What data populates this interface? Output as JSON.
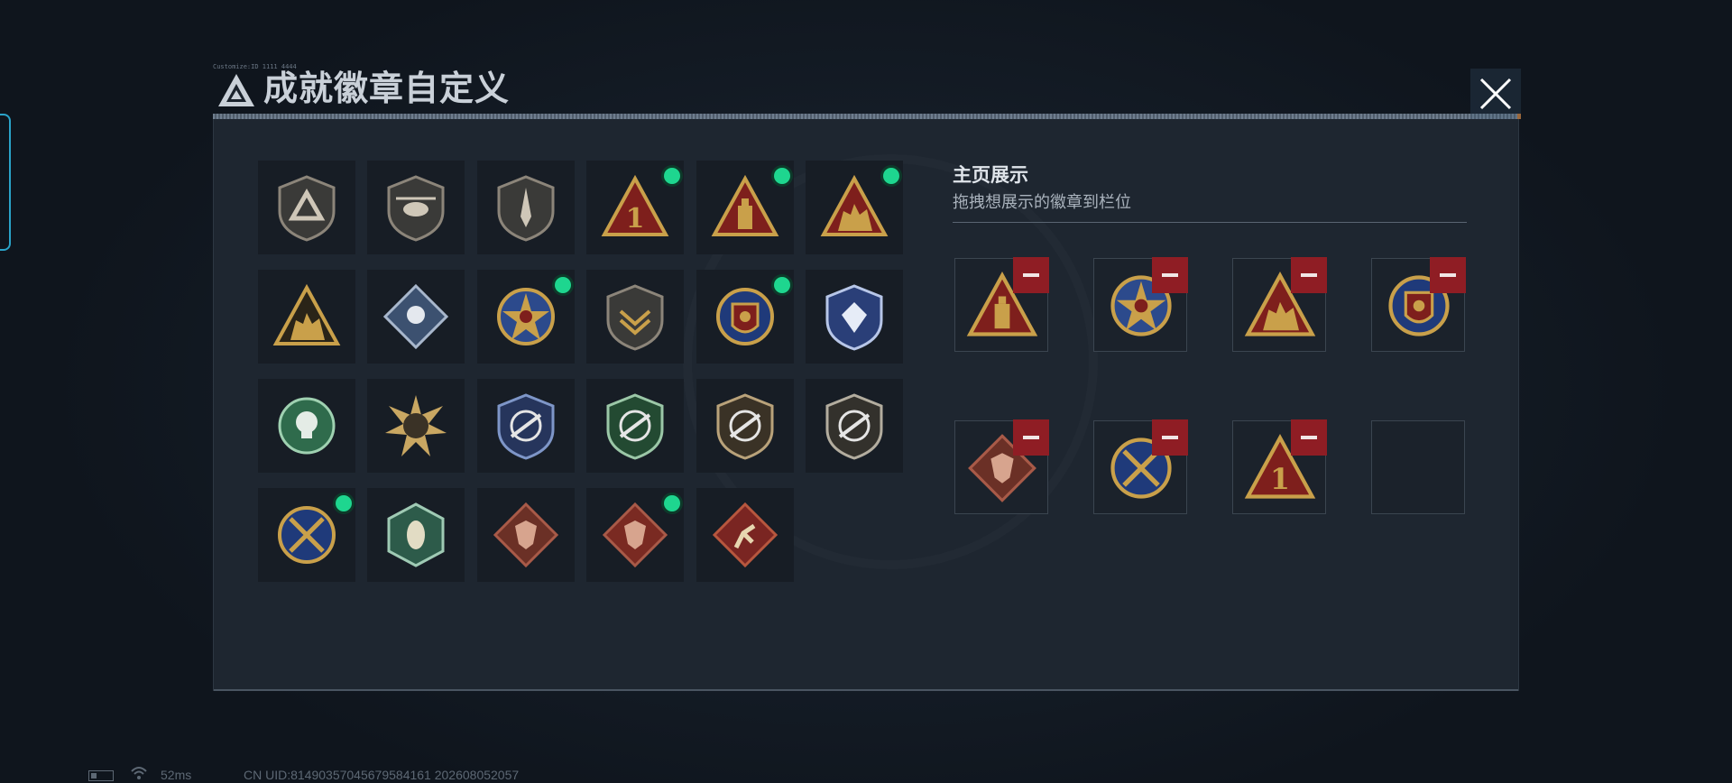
{
  "header": {
    "title": "成就徽章自定义",
    "tiny_text": "Customize:ID 1111 4444",
    "logo_icon": "triangle-logo-icon",
    "close_icon": "close-icon"
  },
  "colors": {
    "accent_green": "#1ed68f",
    "remove_red": "#8f1d24",
    "panel_bg": "#1e2630",
    "gold": "#c9a04a"
  },
  "badges": [
    {
      "icon": "triangle-shield-badge-icon",
      "new": false
    },
    {
      "icon": "helicopter-shield-badge-icon",
      "new": false
    },
    {
      "icon": "dagger-shield-badge-icon",
      "new": false
    },
    {
      "icon": "number-one-triangle-badge-icon",
      "new": true
    },
    {
      "icon": "tower-triangle-badge-icon",
      "new": true
    },
    {
      "icon": "soldiers-triangle-badge-icon",
      "new": true
    },
    {
      "icon": "soldiers-gold-triangle-badge-icon",
      "new": false
    },
    {
      "icon": "rose-diamond-badge-icon",
      "new": false
    },
    {
      "icon": "star-medal-badge-icon",
      "new": true
    },
    {
      "icon": "chevron-shield-badge-icon",
      "new": false
    },
    {
      "icon": "ribbon-crest-badge-icon",
      "new": true
    },
    {
      "icon": "blue-gem-badge-icon",
      "new": false
    },
    {
      "icon": "green-skull-badge-icon",
      "new": false
    },
    {
      "icon": "tank-sunburst-badge-icon",
      "new": false
    },
    {
      "icon": "blue-crosshair-rifle-badge-icon",
      "new": false
    },
    {
      "icon": "green-crosshair-rifle-badge-icon",
      "new": false
    },
    {
      "icon": "gold-crosshair-rifle-badge-icon",
      "new": false
    },
    {
      "icon": "silver-crosshair-rifle-badge-icon",
      "new": false
    },
    {
      "icon": "crossed-swords-crest-badge-icon",
      "new": true
    },
    {
      "icon": "wasp-hexagon-badge-icon",
      "new": false
    },
    {
      "icon": "dragon-diamond-badge-icon",
      "new": false
    },
    {
      "icon": "dragon-diamond-red-badge-icon",
      "new": true
    },
    {
      "icon": "runner-diamond-badge-icon",
      "new": false
    }
  ],
  "showcase": {
    "title": "主页展示",
    "subtitle": "拖拽想展示的徽章到栏位",
    "slots": [
      {
        "icon": "tower-triangle-badge-icon",
        "filled": true
      },
      {
        "icon": "star-medal-badge-icon",
        "filled": true
      },
      {
        "icon": "soldiers-triangle-badge-icon",
        "filled": true
      },
      {
        "icon": "ribbon-crest-badge-icon",
        "filled": true
      },
      {
        "icon": "dragon-diamond-badge-icon",
        "filled": true
      },
      {
        "icon": "crossed-swords-crest-badge-icon",
        "filled": true
      },
      {
        "icon": "number-one-triangle-badge-icon",
        "filled": true
      },
      {
        "icon": "empty-slot",
        "filled": false
      }
    ]
  },
  "status_bar": {
    "ping": "52ms",
    "uid": "CN UID:81490357045679584161 202608052057"
  }
}
